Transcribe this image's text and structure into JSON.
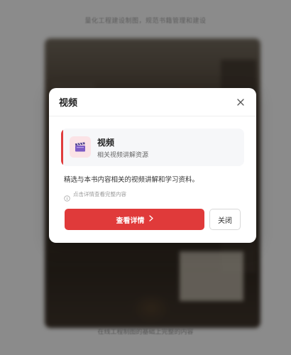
{
  "background": {
    "top_text": "量化工程建设制图，规范书籍管理和建设",
    "bottom_text": "在线工程制图的基础上完整的内容"
  },
  "modal": {
    "title": "视频",
    "close_icon": "close-icon",
    "card": {
      "icon": "clapperboard-icon",
      "title": "视频",
      "subtitle": "相关视频讲解资源",
      "accent_color": "#e03c3c"
    },
    "description": "精选与本书内容相关的视频讲解和学习资料。",
    "hint": {
      "icon": "info-icon",
      "text": "点击详情查看完整内容"
    },
    "primary_button": {
      "label": "查看详情",
      "icon": "chevron-right-icon",
      "color": "#e03a3a"
    },
    "secondary_button": {
      "label": "关闭"
    }
  }
}
